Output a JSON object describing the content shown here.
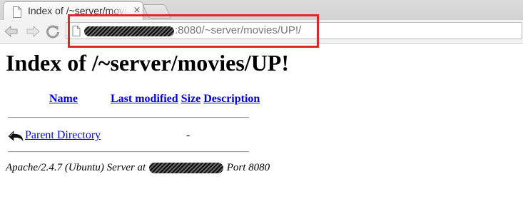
{
  "browser": {
    "tab_title": "Index of /~server/movies/UP!/",
    "tab_close_glyph": "×",
    "url_visible": ":8080/~server/movies/UP!/",
    "highlight_color": "#e3252a"
  },
  "page": {
    "heading": "Index of /~server/movies/UP!",
    "columns": {
      "name": "Name",
      "last_modified": "Last modified",
      "size": "Size",
      "description": "Description"
    },
    "rows": [
      {
        "name": "Parent Directory",
        "last_modified": "",
        "size": "-",
        "description": ""
      }
    ],
    "address": {
      "prefix": "Apache/2.4.7 (Ubuntu) Server at",
      "suffix": "Port 8080"
    }
  },
  "icons": {
    "tab": "page-icon",
    "back": "back-arrow-icon",
    "forward": "forward-arrow-icon",
    "reload": "reload-icon",
    "omnibox": "page-icon",
    "parent": "curved-back-arrow-icon"
  },
  "colors": {
    "link": "#0000ee",
    "redaction": "#1a1a1a"
  }
}
